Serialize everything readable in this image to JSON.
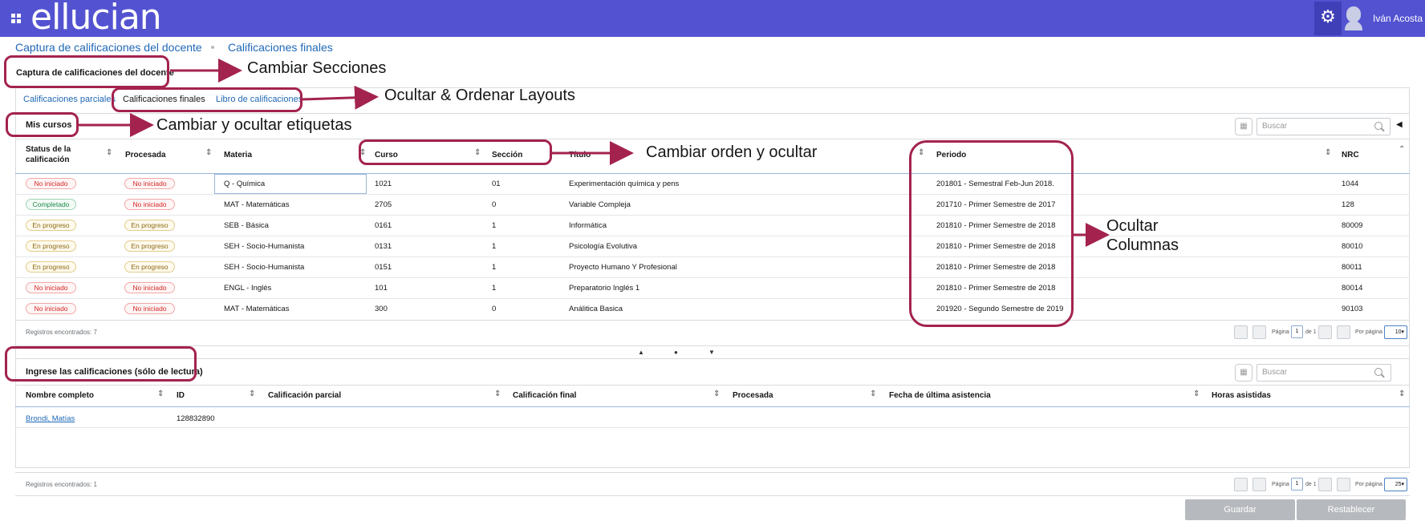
{
  "topbar": {
    "logo": "ellucian",
    "user_name": "Iván Acosta",
    "icons": [
      "menu-grid-icon",
      "gear-icon",
      "user-avatar-icon"
    ]
  },
  "breadcrumb": {
    "first": "Captura de calificaciones del docente",
    "second": "Calificaciones finales"
  },
  "section_title": "Captura de calificaciones del docente",
  "tabs": {
    "partial": "Calificaciones parciales",
    "final": "Calificaciones finales",
    "gradebook": "Libro de calificaciones"
  },
  "courses": {
    "title": "Mis cursos",
    "search_placeholder": "Buscar",
    "headers": {
      "status": "Status de la calificación",
      "processed": "Procesada",
      "subject": "Materia",
      "course": "Curso",
      "section": "Sección",
      "title": "Título",
      "period": "Periodo",
      "crn": "NRC"
    },
    "rows": [
      {
        "status": "No iniciado",
        "status_color": "red",
        "processed": "No iniciado",
        "processed_color": "red",
        "subject": "Q - Química",
        "course": "1021",
        "section": "01",
        "title": "Experimentación química y pens",
        "period": "201801 - Semestral Feb-Jun 2018.",
        "crn": "1044"
      },
      {
        "status": "Completado",
        "status_color": "green",
        "processed": "No iniciado",
        "processed_color": "red",
        "subject": "MAT - Matemáticas",
        "course": "2705",
        "section": "0",
        "title": "Variable Compleja",
        "period": "201710 - Primer Semestre de 2017",
        "crn": "128"
      },
      {
        "status": "En progreso",
        "status_color": "yellow",
        "processed": "En progreso",
        "processed_color": "yellow",
        "subject": "SEB - Básica",
        "course": "0161",
        "section": "1",
        "title": "Informática",
        "period": "201810 - Primer Semestre de 2018",
        "crn": "80009"
      },
      {
        "status": "En progreso",
        "status_color": "yellow",
        "processed": "En progreso",
        "processed_color": "yellow",
        "subject": "SEH - Socio-Humanista",
        "course": "0131",
        "section": "1",
        "title": "Psicología Evolutiva",
        "period": "201810 - Primer Semestre de 2018",
        "crn": "80010"
      },
      {
        "status": "En progreso",
        "status_color": "yellow",
        "processed": "En progreso",
        "processed_color": "yellow",
        "subject": "SEH - Socio-Humanista",
        "course": "0151",
        "section": "1",
        "title": "Proyecto Humano Y Profesional",
        "period": "201810 - Primer Semestre de 2018",
        "crn": "80011"
      },
      {
        "status": "No iniciado",
        "status_color": "red",
        "processed": "No iniciado",
        "processed_color": "red",
        "subject": "ENGL - Inglés",
        "course": "101",
        "section": "1",
        "title": "Preparatorio Inglés 1",
        "period": "201810 - Primer Semestre de 2018",
        "crn": "80014"
      },
      {
        "status": "No iniciado",
        "status_color": "red",
        "processed": "No iniciado",
        "processed_color": "red",
        "subject": "MAT - Matemáticas",
        "course": "300",
        "section": "0",
        "title": "Análitica Basica",
        "period": "201920 - Segundo Semestre de 2019",
        "crn": "90103"
      }
    ],
    "records": "Registros encontrados: 7",
    "pagination": {
      "page_label": "Página",
      "page": "1",
      "of": "de 1",
      "per_page_label": "Por página",
      "per_page": "10"
    }
  },
  "grades": {
    "title": "Ingrese las calificaciones (sólo de lectura)",
    "search_placeholder": "Buscar",
    "headers": {
      "name": "Nombre completo",
      "id": "ID",
      "partial": "Calificación parcial",
      "final": "Calificación final",
      "processed": "Procesada",
      "last_attendance": "Fecha de última asistencia",
      "hours": "Horas asistidas"
    },
    "rows": [
      {
        "name": "Brondi, Matías",
        "id": "128832890"
      }
    ],
    "records": "Registros encontrados: 1",
    "pagination": {
      "page_label": "Página",
      "page": "1",
      "of": "de 1",
      "per_page_label": "Por página",
      "per_page": "25"
    }
  },
  "buttons": {
    "save": "Guardar",
    "reset": "Restablecer"
  },
  "annotations": {
    "sections": "Cambiar Secciones",
    "layouts": "Ocultar & Ordenar Layouts",
    "labels": "Cambiar y ocultar etiquetas",
    "order": "Cambiar orden y ocultar",
    "columns_1": "Ocultar",
    "columns_2": "Columnas"
  },
  "colors": {
    "topbar": "#5353d1",
    "link": "#1f68b7",
    "annotation": "#a3234e"
  }
}
